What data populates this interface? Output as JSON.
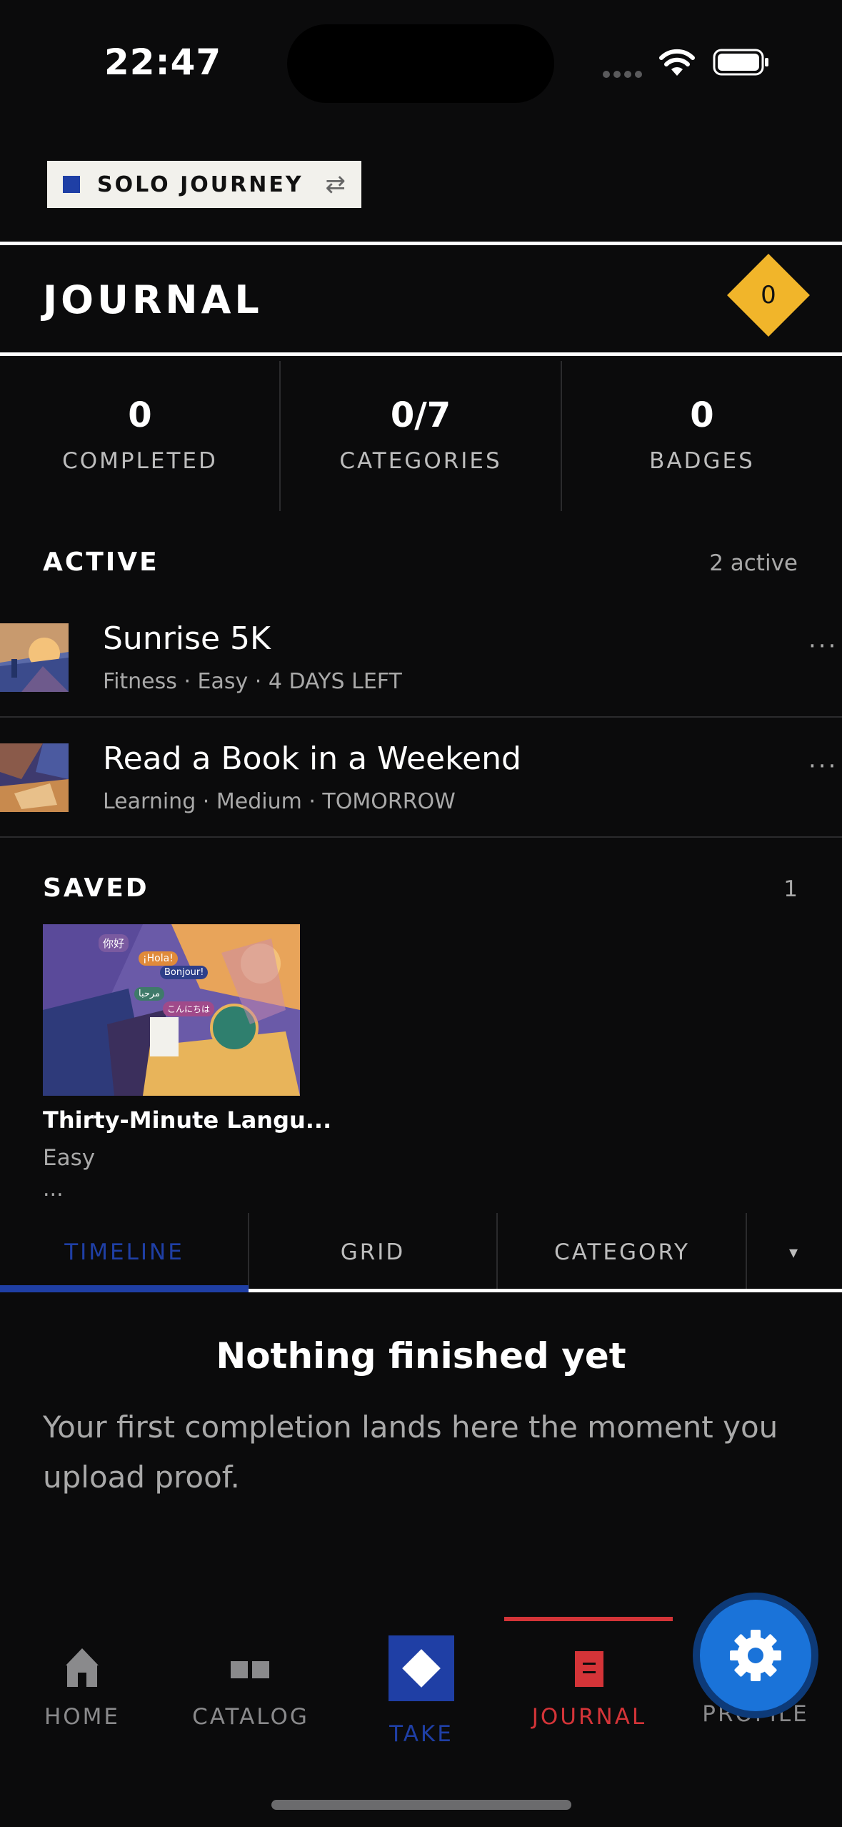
{
  "status_bar": {
    "time": "22:47"
  },
  "mode": {
    "label": "SOLO JOURNEY",
    "swap_icon": "swap-arrows-icon"
  },
  "header": {
    "title": "JOURNAL",
    "badge_value": "0"
  },
  "stats": [
    {
      "value": "0",
      "label": "COMPLETED"
    },
    {
      "value": "0/7",
      "label": "CATEGORIES"
    },
    {
      "value": "0",
      "label": "BADGES"
    }
  ],
  "active": {
    "title": "ACTIVE",
    "count": "2 active",
    "items": [
      {
        "title": "Sunrise 5K",
        "subtitle": "Fitness · Easy · 4 DAYS LEFT",
        "more": "···"
      },
      {
        "title": "Read a Book in a Weekend",
        "subtitle": "Learning · Medium · TOMORROW",
        "more": "···"
      }
    ]
  },
  "saved": {
    "title": "SAVED",
    "count": "1",
    "items": [
      {
        "title": "Thirty-Minute Langu...",
        "difficulty": "Easy",
        "more": "...",
        "bubbles": [
          "你好",
          "¡Hola!",
          "Bonjour!",
          "مرحبا",
          "こんにちは"
        ]
      }
    ]
  },
  "tabs": [
    {
      "label": "TIMELINE",
      "active": true
    },
    {
      "label": "GRID",
      "active": false
    },
    {
      "label": "CATEGORY",
      "active": false
    },
    {
      "label": "▾",
      "active": false
    }
  ],
  "empty_state": {
    "title": "Nothing finished yet",
    "body": "Your first completion lands here the moment you upload proof."
  },
  "nav": {
    "items": [
      {
        "label": "HOME",
        "icon": "home-icon"
      },
      {
        "label": "CATALOG",
        "icon": "catalog-icon"
      },
      {
        "label": "TAKE",
        "icon": "take-diamond-icon"
      },
      {
        "label": "JOURNAL",
        "icon": "journal-icon",
        "active": true
      },
      {
        "label": "PROFILE",
        "icon": "profile-icon"
      }
    ],
    "fab_icon": "gear-icon"
  },
  "colors": {
    "background": "#0b0b0c",
    "accent_blue": "#1f3fa5",
    "accent_red": "#d43438",
    "badge_yellow": "#f1b52a",
    "fab_blue": "#1a73d9"
  }
}
